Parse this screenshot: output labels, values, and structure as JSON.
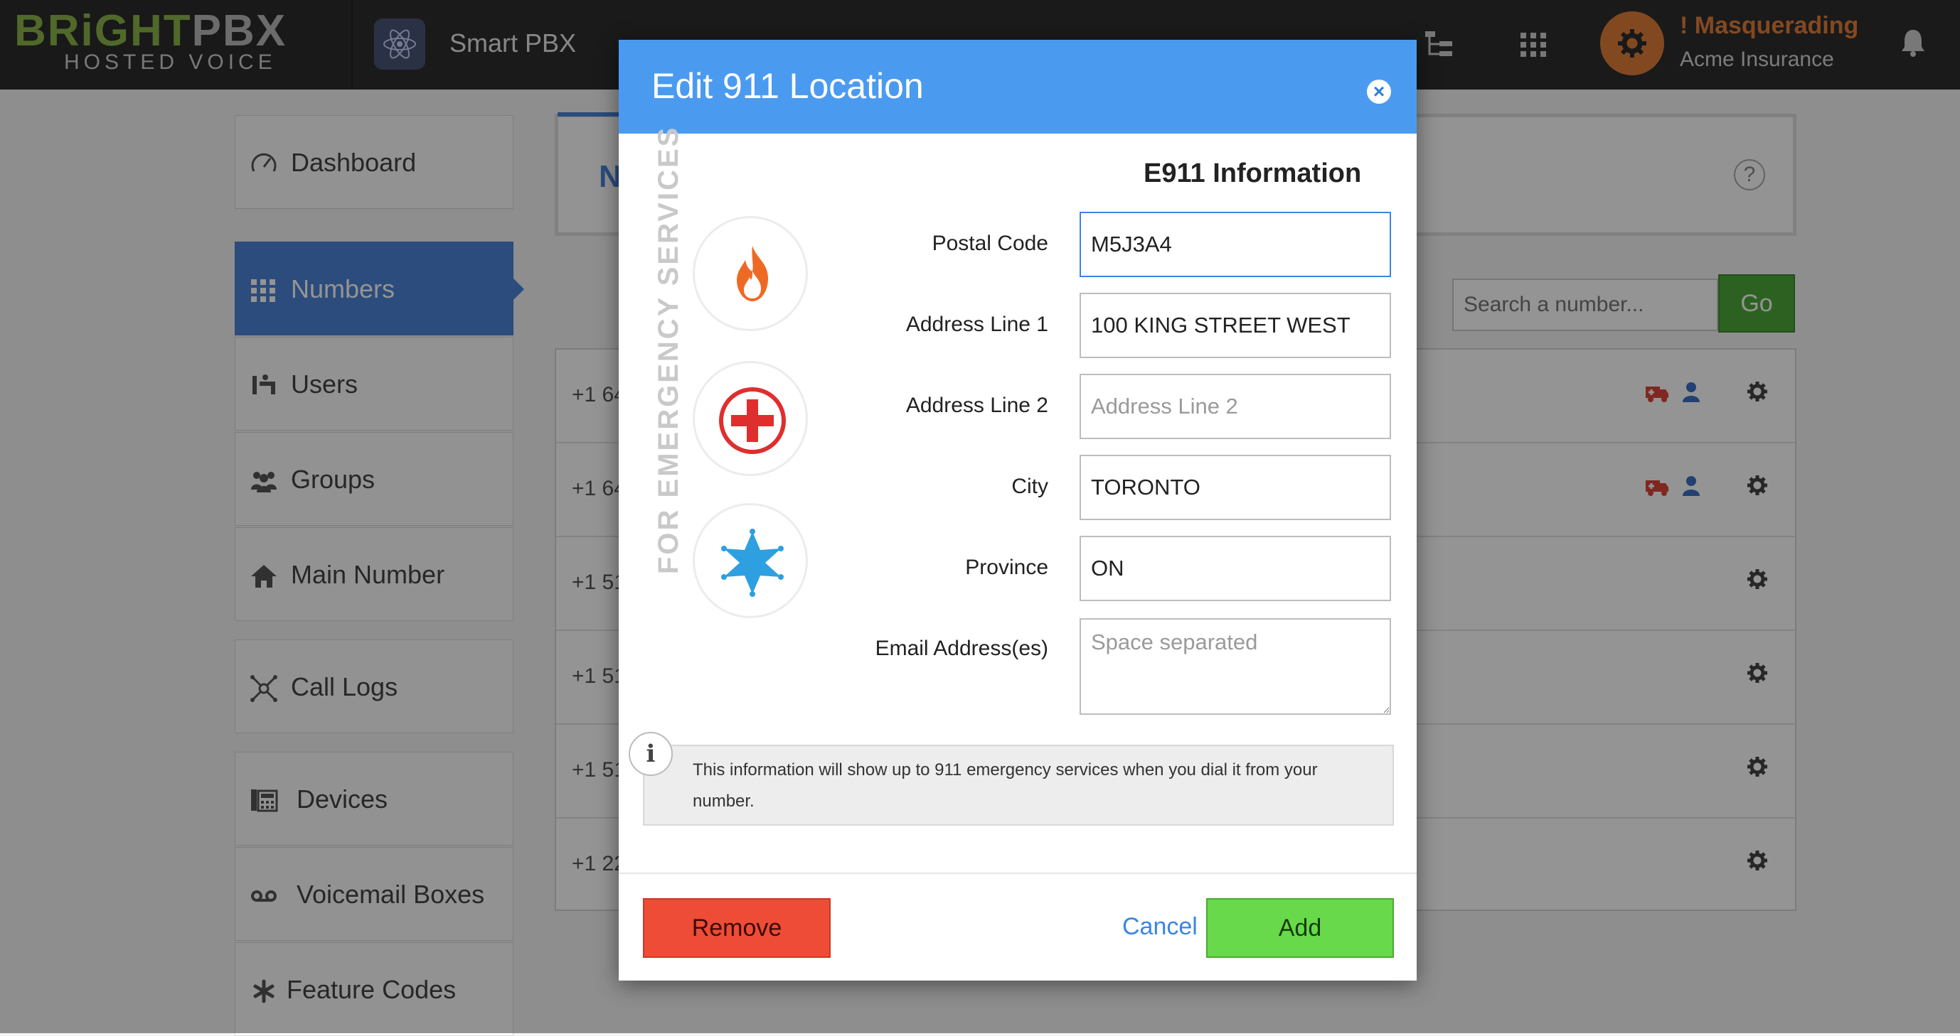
{
  "topbar": {
    "logo_bright": "BRiGHT",
    "logo_pbx": "PBX",
    "logo_sub": "HOSTED VOICE",
    "app_title": "Smart PBX",
    "masquerading": "! Masquerading",
    "company": "Acme Insurance"
  },
  "sidebar": {
    "items": [
      {
        "label": "Dashboard",
        "icon": "speedometer-icon"
      },
      {
        "label": "Numbers",
        "icon": "grid-icon",
        "active": true
      },
      {
        "label": "Users",
        "icon": "users-icon"
      },
      {
        "label": "Groups",
        "icon": "group-icon"
      },
      {
        "label": "Main Number",
        "icon": "home-icon"
      },
      {
        "label": "Call Logs",
        "icon": "network-icon"
      },
      {
        "label": "Devices",
        "icon": "phone-desk-icon"
      },
      {
        "label": "Voicemail Boxes",
        "icon": "voicemail-icon"
      },
      {
        "label": "Feature Codes",
        "icon": "asterisk-icon"
      }
    ]
  },
  "main": {
    "header_letter": "N",
    "search_placeholder": "Search a number...",
    "go_label": "Go",
    "rows": [
      {
        "number": "+1 64"
      },
      {
        "number": "+1 64"
      },
      {
        "number": "+1 51"
      },
      {
        "number": "+1 51"
      },
      {
        "number": "+1 51"
      },
      {
        "number": "+1 22"
      }
    ]
  },
  "modal": {
    "title": "Edit 911 Location",
    "close_glyph": "×",
    "section_title": "E911 Information",
    "vertical_text": "FOR EMERGENCY SERVICES",
    "fields": {
      "postal_code": {
        "label": "Postal Code",
        "value": "M5J3A4",
        "placeholder": ""
      },
      "address1": {
        "label": "Address Line 1",
        "value": "100 KING STREET WEST",
        "placeholder": ""
      },
      "address2": {
        "label": "Address Line 2",
        "value": "",
        "placeholder": "Address Line 2"
      },
      "city": {
        "label": "City",
        "value": "TORONTO",
        "placeholder": ""
      },
      "province": {
        "label": "Province",
        "value": "ON",
        "placeholder": ""
      },
      "emails": {
        "label": "Email Address(es)",
        "value": "",
        "placeholder": "Space separated"
      }
    },
    "info_text": "This information will show up to 911 emergency services when you dial it from your number.",
    "buttons": {
      "remove": "Remove",
      "cancel": "Cancel",
      "add": "Add"
    }
  },
  "colors": {
    "accent_blue": "#4a9bf0",
    "sidebar_active": "#4a84d6",
    "remove_red": "#ee4c36",
    "add_green": "#68d94a",
    "masquerade_orange": "#e37e37",
    "logo_green": "#8ab64a"
  }
}
